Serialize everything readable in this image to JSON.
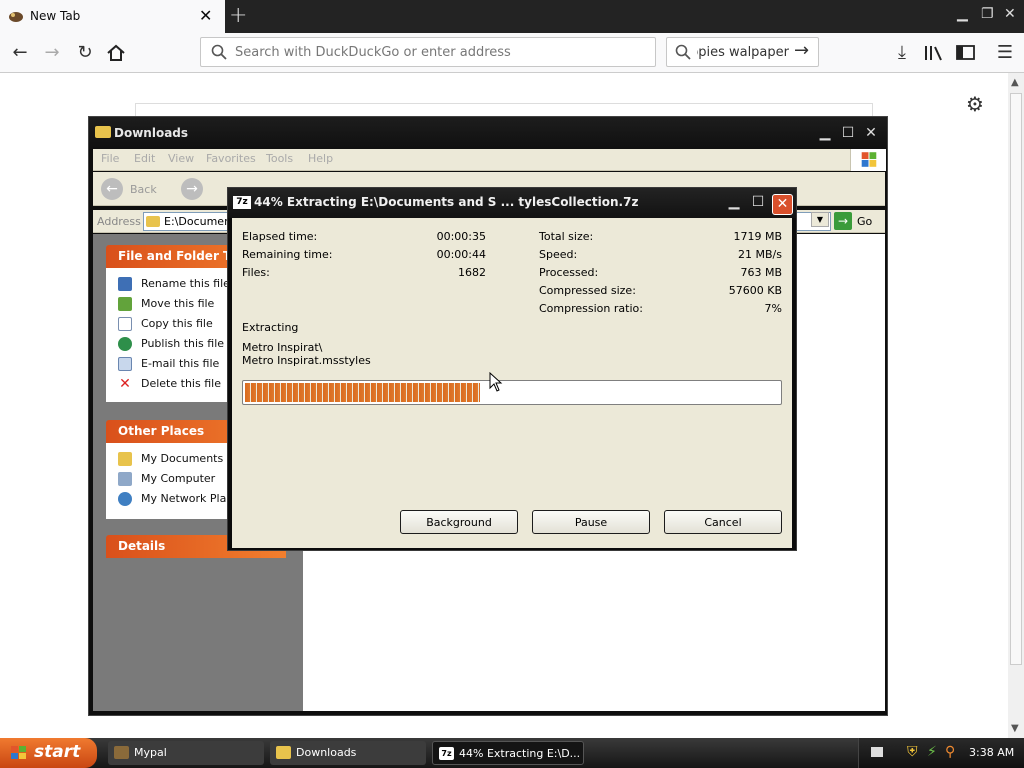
{
  "browser": {
    "tab_title": "New Tab",
    "url_placeholder": "Search with DuckDuckGo or enter address",
    "search_text": "ppies walpaper"
  },
  "explorer": {
    "title": "Downloads",
    "menu": [
      "File",
      "Edit",
      "View",
      "Favorites",
      "Tools",
      "Help"
    ],
    "toolbar": {
      "back": "Back"
    },
    "address_label": "Address",
    "address_value": "E:\\Document",
    "go_label": "Go",
    "file_tasks": {
      "header": "File and Folder Tasks",
      "items": [
        "Rename this file",
        "Move this file",
        "Copy this file",
        "Publish this file to",
        "E-mail this file",
        "Delete this file"
      ]
    },
    "other_places": {
      "header": "Other Places",
      "items": [
        "My Documents",
        "My Computer",
        "My Network Places"
      ]
    },
    "details_header": "Details"
  },
  "dialog": {
    "title": "44% Extracting E:\\Documents and S ... tylesCollection.7z",
    "left_stats": [
      {
        "label": "Elapsed time:",
        "value": "00:00:35"
      },
      {
        "label": "Remaining time:",
        "value": "00:00:44"
      },
      {
        "label": "Files:",
        "value": "1682"
      }
    ],
    "right_stats": [
      {
        "label": "Total size:",
        "value": "1719 MB"
      },
      {
        "label": "Speed:",
        "value": "21 MB/s"
      },
      {
        "label": "Processed:",
        "value": "763 MB"
      },
      {
        "label": "Compressed size:",
        "value": "57600 KB"
      },
      {
        "label": "Compression ratio:",
        "value": "7%"
      }
    ],
    "status": "Extracting",
    "path_line1": "Metro Inspirat\\",
    "path_line2": "Metro Inspirat.msstyles",
    "progress_fraction": 0.44,
    "buttons": {
      "background": "Background",
      "pause": "Pause",
      "cancel": "Cancel"
    }
  },
  "taskbar": {
    "start": "start",
    "items": [
      "Mypal",
      "Downloads",
      "44% Extracting E:\\D..."
    ],
    "clock": "3:38 AM"
  },
  "colors": {
    "xp_panel_orange": "#e8652a",
    "progress_orange": "#d96a1e",
    "dialog_close_red": "#d9502c"
  }
}
